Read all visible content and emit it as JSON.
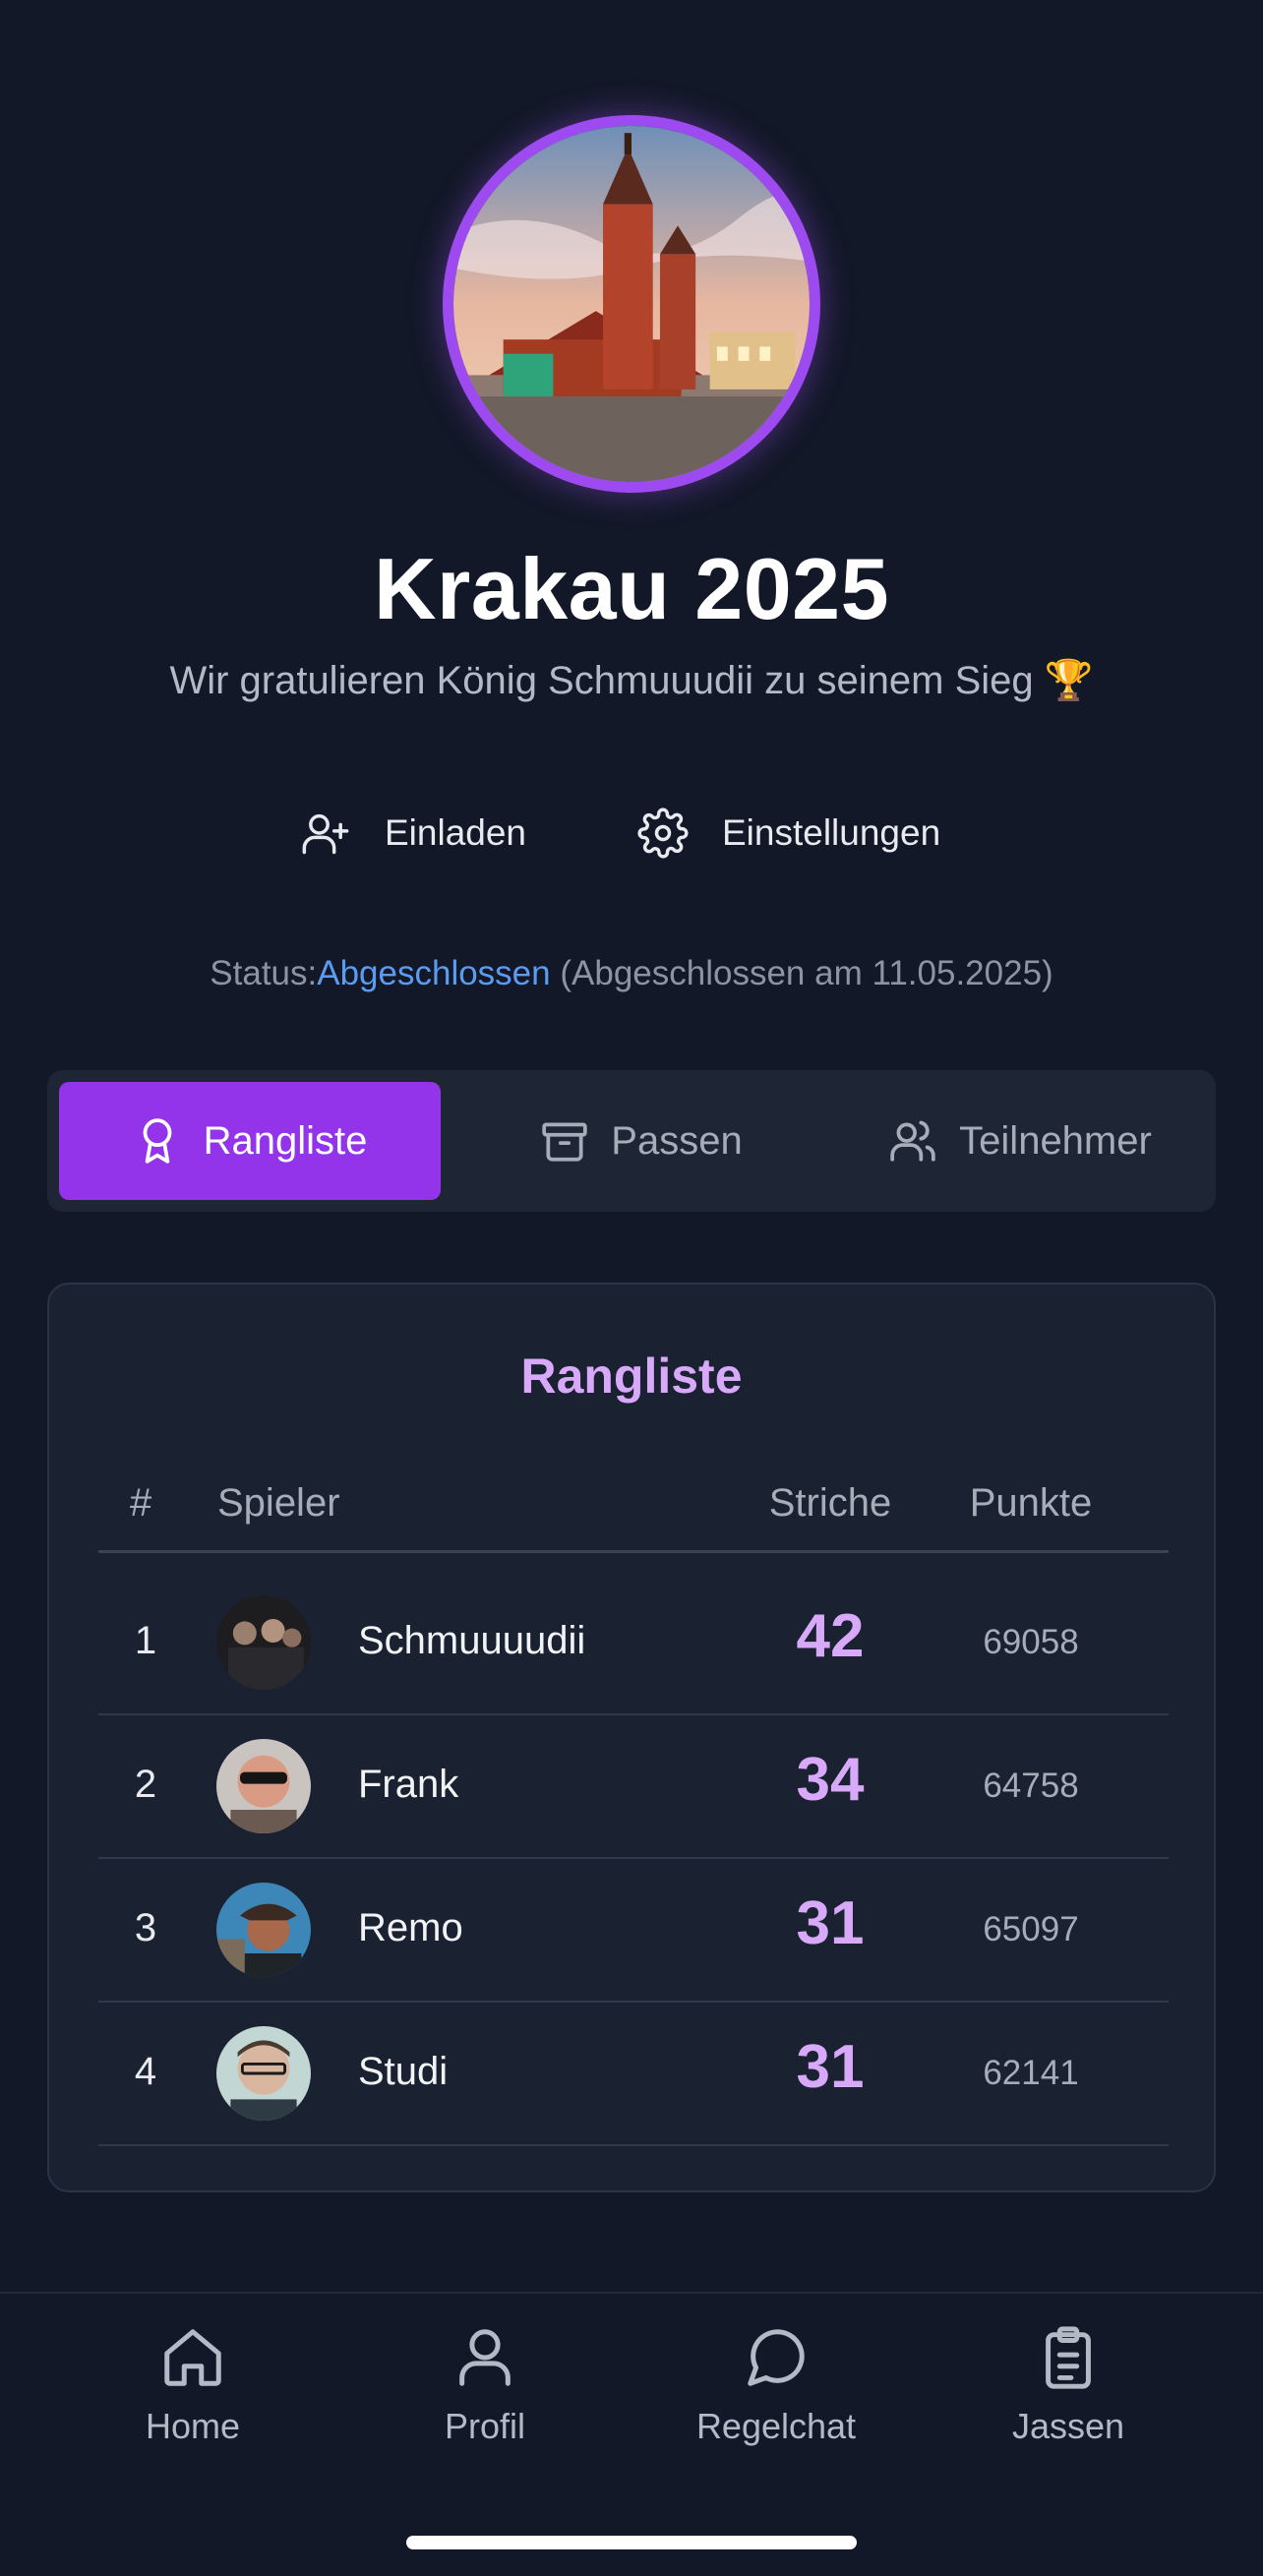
{
  "header": {
    "title": "Krakau 2025",
    "subtitle": "Wir gratulieren König Schmuuudii zu seinem Sieg 🏆",
    "avatar_image": "krakow-church-photo"
  },
  "actions": {
    "invite_label": "Einladen",
    "settings_label": "Einstellungen"
  },
  "status": {
    "label": "Status:",
    "value": "Abgeschlossen",
    "detail": "(Abgeschlossen am 11.05.2025)"
  },
  "tabs": [
    {
      "label": "Rangliste",
      "icon": "award-icon",
      "active": true
    },
    {
      "label": "Passen",
      "icon": "archive-icon",
      "active": false
    },
    {
      "label": "Teilnehmer",
      "icon": "users-icon",
      "active": false
    }
  ],
  "ranking": {
    "title": "Rangliste",
    "headers": {
      "rank": "#",
      "player": "Spieler",
      "strokes": "Striche",
      "points": "Punkte"
    },
    "rows": [
      {
        "rank": "1",
        "name": "Schmuuuudii",
        "strokes": "42",
        "points": "69058"
      },
      {
        "rank": "2",
        "name": "Frank",
        "strokes": "34",
        "points": "64758"
      },
      {
        "rank": "3",
        "name": "Remo",
        "strokes": "31",
        "points": "65097"
      },
      {
        "rank": "4",
        "name": "Studi",
        "strokes": "31",
        "points": "62141"
      }
    ]
  },
  "nav": [
    {
      "label": "Home",
      "icon": "home-icon"
    },
    {
      "label": "Profil",
      "icon": "user-icon"
    },
    {
      "label": "Regelchat",
      "icon": "chat-icon"
    },
    {
      "label": "Jassen",
      "icon": "clipboard-icon"
    }
  ],
  "colors": {
    "background": "#121827",
    "accent": "#9333ea",
    "accent_text": "#d8a9f8",
    "status_link": "#5b9bf0"
  }
}
